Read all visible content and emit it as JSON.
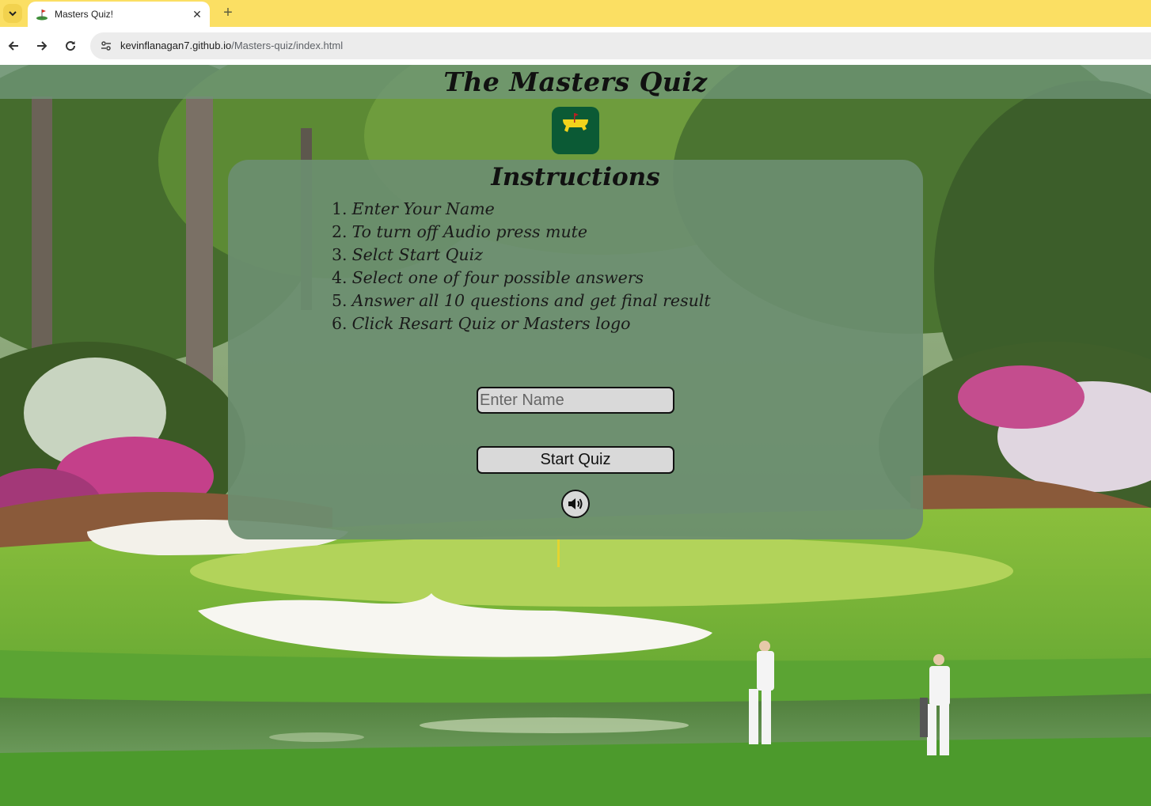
{
  "browser": {
    "tab_title": "Masters Quiz!",
    "url_host": "kevinflanagan7.github.io",
    "url_path": "/Masters-quiz/index.html"
  },
  "page": {
    "title": "The Masters Quiz",
    "logo_text": "Masters",
    "instructions_title": "Instructions",
    "steps": [
      {
        "num": "1.",
        "text": "Enter Your Name"
      },
      {
        "num": "2.",
        "text": "To turn off Audio press mute"
      },
      {
        "num": "3.",
        "text": "Selct Start Quiz"
      },
      {
        "num": "4.",
        "text": "Select one of four possible answers"
      },
      {
        "num": "5.",
        "text": "Answer all 10 questions and get final result"
      },
      {
        "num": "6.",
        "text": "Click Resart Quiz or Masters logo"
      }
    ],
    "name_placeholder": "Enter Name",
    "start_button": "Start Quiz",
    "mute_icon": "speaker-icon"
  },
  "colors": {
    "tabstrip": "#fbdf63",
    "panel": "#6c8e70",
    "header_bar": "#709678",
    "logo_green": "#0b5a35",
    "logo_yellow": "#f2d31b"
  }
}
